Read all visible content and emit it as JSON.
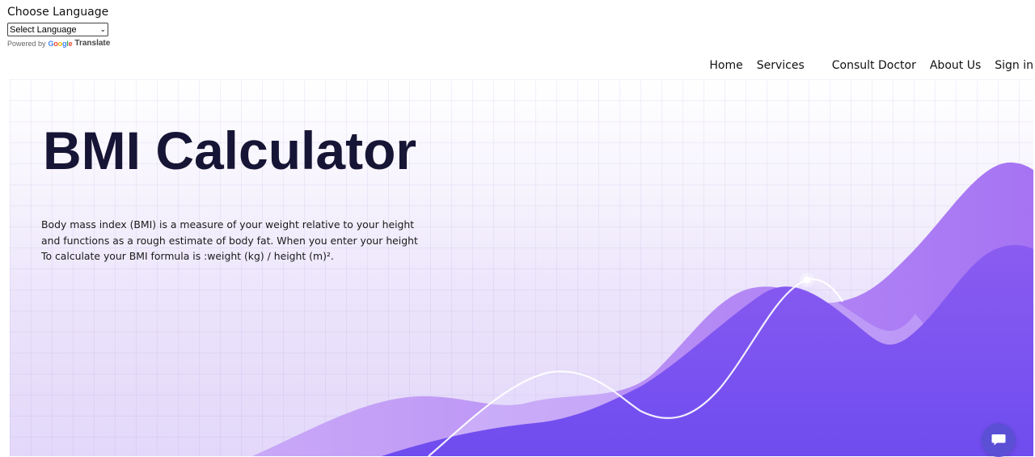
{
  "translate": {
    "title": "Choose Language",
    "select_value": "Select Language",
    "powered_by": "Powered by",
    "google_letters": [
      "G",
      "o",
      "o",
      "g",
      "l",
      "e"
    ],
    "translate_label": "Translate"
  },
  "nav": {
    "items": [
      {
        "label": "Home"
      },
      {
        "label": "Services"
      },
      {
        "label": "Consult Doctor"
      },
      {
        "label": "About Us"
      },
      {
        "label": "Sign in"
      }
    ]
  },
  "hero": {
    "title": "BMI Calculator",
    "description_lines": [
      "Body mass index (BMI) is a measure of your weight relative to your height",
      "and functions as a rough estimate of body fat. When you enter your height",
      "To calculate your BMI formula is :weight (kg) / height (m)²."
    ]
  },
  "chat": {
    "icon": "chat-icon"
  },
  "colors": {
    "title": "#171535",
    "wave_light": "#b48cf5",
    "wave_dark": "#7a55f0",
    "chat_button": "#5b4fd6"
  }
}
